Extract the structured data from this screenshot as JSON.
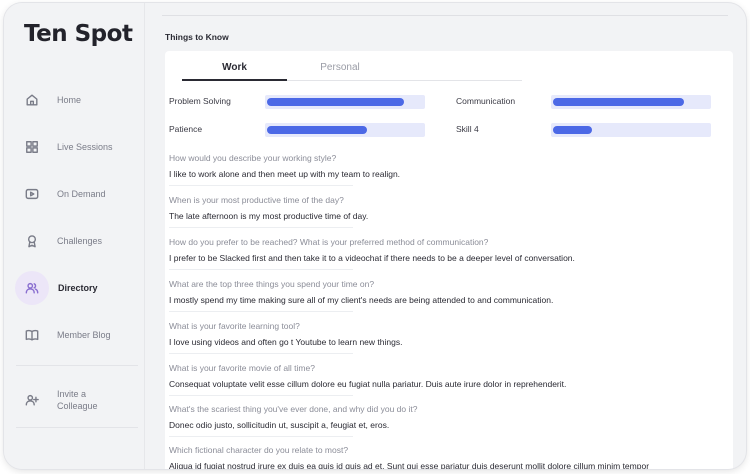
{
  "app": {
    "logo_text": "Ten Spot"
  },
  "sidebar": {
    "items": [
      {
        "label": "Home",
        "icon": "home-icon"
      },
      {
        "label": "Live Sessions",
        "icon": "grid-icon"
      },
      {
        "label": "On Demand",
        "icon": "play-icon"
      },
      {
        "label": "Challenges",
        "icon": "award-icon"
      },
      {
        "label": "Directory",
        "icon": "users-icon",
        "active": true
      },
      {
        "label": "Member Blog",
        "icon": "book-icon"
      }
    ],
    "invite": {
      "line1": "Invite a",
      "line2": "Colleague",
      "icon": "user-plus-icon"
    }
  },
  "main": {
    "section_title": "Things to Know",
    "tabs": [
      {
        "label": "Work",
        "active": true
      },
      {
        "label": "Personal"
      }
    ],
    "skills": [
      {
        "name": "Problem Solving",
        "level": 0.88
      },
      {
        "name": "Communication",
        "level": 0.84
      },
      {
        "name": "Patience",
        "level": 0.64
      },
      {
        "name": "Skill 4",
        "level": 0.25
      }
    ],
    "qa": [
      {
        "q": "How would you describe your working style?",
        "a": "I like to work alone and then meet up with my team to realign."
      },
      {
        "q": "When is your most productive time of the day?",
        "a": "The late afternoon is my most productive time of day."
      },
      {
        "q": "How do you prefer to be reached? What is your preferred method of communication?",
        "a": "I prefer to be Slacked first and then take it to a videochat if there needs to be a deeper level of conversation."
      },
      {
        "q": "What are the top three things you spend your time on?",
        "a": "I mostly spend my time making sure all of my client's needs are being attended to and communication."
      },
      {
        "q": "What is your favorite learning tool?",
        "a": "I love using videos and often go t Youtube to learn new things."
      },
      {
        "q": "What is your favorite movie of all time?",
        "a": "Consequat voluptate velit esse cillum dolore eu fugiat nulla pariatur. Duis aute irure dolor in reprehenderit."
      },
      {
        "q": "What's the scariest thing you've ever done, and why did you do it?",
        "a": "Donec odio justo, sollicitudin ut, suscipit a, feugiat et, eros."
      },
      {
        "q": "Which fictional character do you relate to most?",
        "a": "Aliqua id fugiat nostrud irure ex duis ea quis id quis ad et. Sunt qui esse pariatur duis deserunt mollit dolore cillum minim tempor"
      }
    ]
  },
  "colors": {
    "accent": "#4c69e6",
    "track": "#e6e9fb",
    "active_nav_bg": "#ece6f8"
  }
}
